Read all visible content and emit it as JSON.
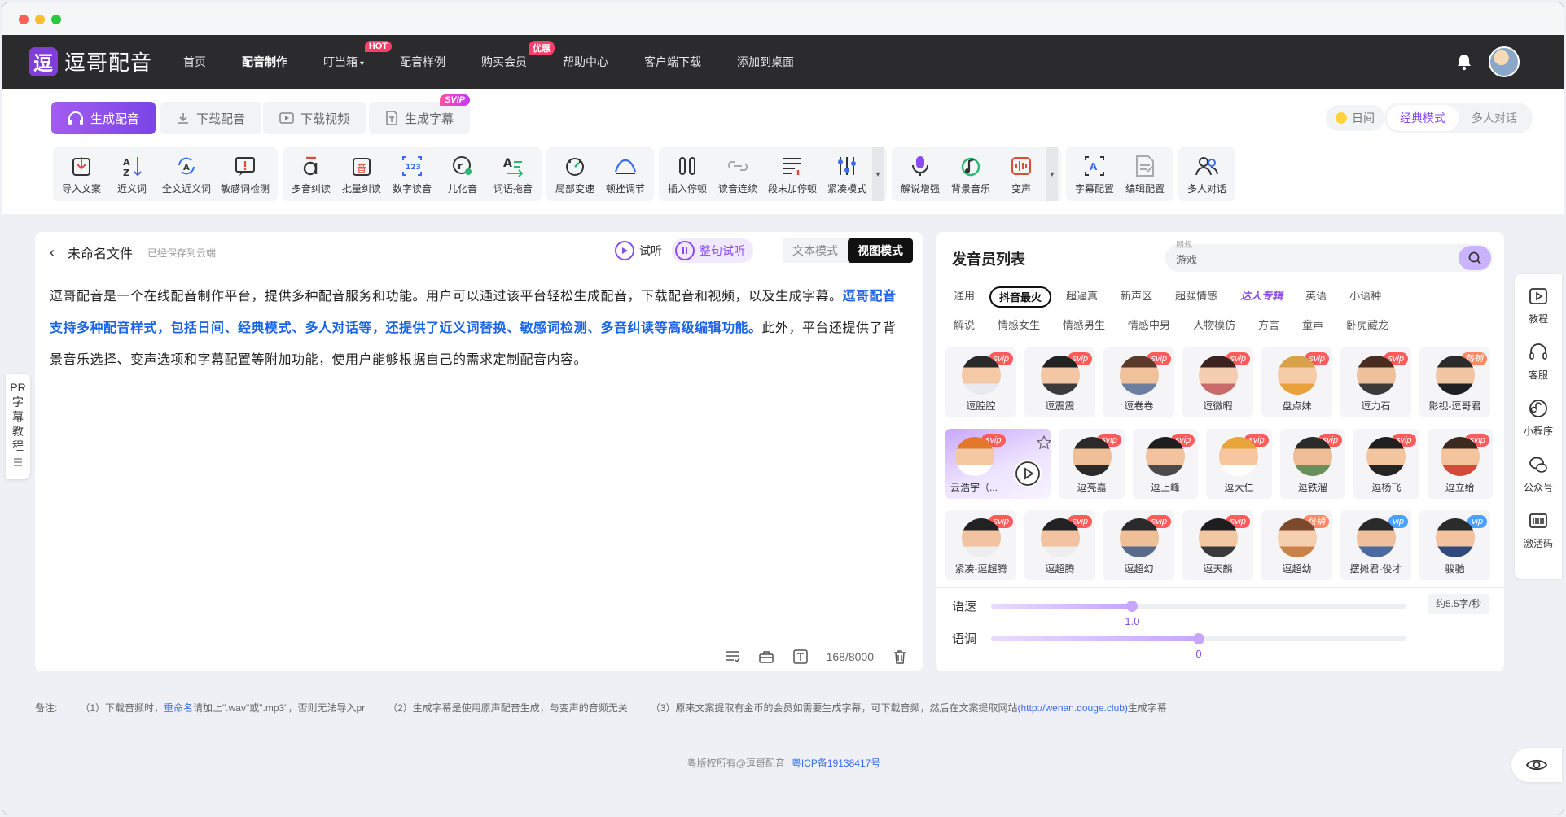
{
  "nav": {
    "logo_mark": "逗",
    "logo_text": "逗哥配音",
    "items": [
      {
        "label": "首页",
        "active": false,
        "badge": ""
      },
      {
        "label": "配音制作",
        "active": true,
        "badge": ""
      },
      {
        "label": "叮当箱",
        "active": false,
        "badge": "HOT",
        "caret": "▾"
      },
      {
        "label": "配音样例",
        "active": false,
        "badge": ""
      },
      {
        "label": "购买会员",
        "active": false,
        "badge": "优惠"
      },
      {
        "label": "帮助中心",
        "active": false,
        "badge": ""
      },
      {
        "label": "客户端下载",
        "active": false,
        "badge": ""
      },
      {
        "label": "添加到桌面",
        "active": false,
        "badge": ""
      }
    ]
  },
  "tabs": [
    {
      "label": "生成配音",
      "icon": "headphone-icon"
    },
    {
      "label": "下载配音",
      "icon": "download-icon"
    },
    {
      "label": "下载视频",
      "icon": "video-icon"
    },
    {
      "label": "生成字幕",
      "icon": "subtitle-icon",
      "badge": "SVIP"
    }
  ],
  "display_mode": "日间",
  "modes": [
    "经典模式",
    "多人对话"
  ],
  "tool_groups": [
    [
      {
        "label": "导入文案"
      },
      {
        "label": "近义词"
      },
      {
        "label": "全文近义词"
      },
      {
        "label": "敏感词检测"
      }
    ],
    [
      {
        "label": "多音纠读"
      },
      {
        "label": "批量纠读"
      },
      {
        "label": "数字读音"
      },
      {
        "label": "儿化音"
      },
      {
        "label": "词语拖音"
      }
    ],
    [
      {
        "label": "局部变速"
      },
      {
        "label": "顿挫调节"
      }
    ],
    [
      {
        "label": "插入停顿"
      },
      {
        "label": "读音连续"
      },
      {
        "label": "段末加停顿"
      },
      {
        "label": "紧凑模式"
      }
    ],
    [
      {
        "label": "解说增强"
      },
      {
        "label": "背景音乐"
      },
      {
        "label": "变声"
      }
    ],
    [
      {
        "label": "字幕配置"
      },
      {
        "label": "编辑配置"
      }
    ],
    [
      {
        "label": "多人对话"
      }
    ]
  ],
  "editor": {
    "back": "‹",
    "title": "未命名文件",
    "saved": "已经保存到云端",
    "preview": "试听",
    "sentence_preview": "整句试听",
    "view_modes": [
      "文本模式",
      "视图模式"
    ],
    "text_part1": "逗哥配音是一个在线配音制作平台，提供多种配音服务和功能。用户可以通过该平台轻松生成配音，下载配音和视频，以及生成字幕。",
    "text_highlight": "逗哥配音支持多种配音样式，包括日间、经典模式、多人对话等，还提供了近义词替换、敏感词检测、多音纠读等高级编辑功能。",
    "text_part2": "此外，平台还提供了背景音乐选择、变声选项和字幕配置等附加功能，使用户能够根据自己的需求定制配音内容。",
    "counter": "168/8000"
  },
  "left_tab": {
    "chars": [
      "PR",
      "字",
      "幕",
      "教",
      "程"
    ]
  },
  "voices": {
    "title": "发音员列表",
    "search_hint": "朗规",
    "search_value": "游戏",
    "categories_row1": [
      "通用",
      "抖音最火",
      "超逼真",
      "新声区",
      "超强情感",
      "达人专辑",
      "英语",
      "小语种"
    ],
    "categories_row2": [
      "解说",
      "情感女生",
      "情感男生",
      "情感中男",
      "人物模仿",
      "方言",
      "童声",
      "卧虎藏龙"
    ],
    "active_category": "抖音最火",
    "rows": [
      [
        {
          "name": "逗腔腔",
          "tag": "svip",
          "skin": "#f6c9a6",
          "hair": "#2a2a2a",
          "shirt": "#e8eaf0"
        },
        {
          "name": "逗震震",
          "tag": "svip",
          "skin": "#f3c7a4",
          "hair": "#222222",
          "shirt": "#3b3b3b"
        },
        {
          "name": "逗卷卷",
          "tag": "svip",
          "skin": "#f0c19b",
          "hair": "#5a3a2a",
          "shirt": "#6c7fa0"
        },
        {
          "name": "逗微暇",
          "tag": "svip",
          "skin": "#f5cdb0",
          "hair": "#3a2320",
          "shirt": "#c96b6b"
        },
        {
          "name": "盘点妹",
          "tag": "svip",
          "skin": "#f6cba8",
          "hair": "#d8a24a",
          "shirt": "#e9a23b"
        },
        {
          "name": "逗力石",
          "tag": "svip",
          "skin": "#efc09c",
          "hair": "#4a2d20",
          "shirt": "#3a3a3a"
        },
        {
          "name": "影视-逗哥君",
          "tag": "热销",
          "skin": "#f1c6a2",
          "hair": "#2b2b2b",
          "shirt": "#1f1f24"
        }
      ],
      [
        {
          "name": "云浩宇（...",
          "tag": "svip",
          "skin": "#f4c8a2",
          "hair": "#e1782a",
          "shirt": "#ffffff",
          "selected": true
        },
        {
          "name": "逗亮嘉",
          "tag": "svip",
          "skin": "#efbf98",
          "hair": "#2a2a2a",
          "shirt": "#2a2a2a"
        },
        {
          "name": "逗上峰",
          "tag": "svip",
          "skin": "#f2c39e",
          "hair": "#1e1e1e",
          "shirt": "#4a4a4a"
        },
        {
          "name": "逗大仁",
          "tag": "svip",
          "skin": "#f6c79e",
          "hair": "#e8a63a",
          "shirt": "#ffffff"
        },
        {
          "name": "逗铁溜",
          "tag": "svip",
          "skin": "#eebd95",
          "hair": "#2b2b2b",
          "shirt": "#6b8f5a"
        },
        {
          "name": "逗杨飞",
          "tag": "svip",
          "skin": "#f3c6a0",
          "hair": "#1f1f1f",
          "shirt": "#242424"
        },
        {
          "name": "逗立给",
          "tag": "svip",
          "skin": "#f4c59c",
          "hair": "#3a2a20",
          "shirt": "#d24a3a"
        }
      ],
      [
        {
          "name": "紧凑-逗超腾",
          "tag": "svip",
          "skin": "#f1c3a0",
          "hair": "#222222",
          "shirt": "#eeeeee"
        },
        {
          "name": "逗超腾",
          "tag": "svip",
          "skin": "#f1c3a0",
          "hair": "#222222",
          "shirt": "#eeeeee"
        },
        {
          "name": "逗超幻",
          "tag": "svip",
          "skin": "#efbf98",
          "hair": "#2a2a2a",
          "shirt": "#5a6a8a"
        },
        {
          "name": "逗天麟",
          "tag": "svip",
          "skin": "#f3c7a2",
          "hair": "#1e1e1e",
          "shirt": "#3a3a3a"
        },
        {
          "name": "逗超幼",
          "tag": "热销",
          "skin": "#f6cfae",
          "hair": "#7a4a2a",
          "shirt": "#c9834a"
        },
        {
          "name": "摆摊君-俊才",
          "tag": "vip",
          "skin": "#efc09c",
          "hair": "#2a2a2a",
          "shirt": "#4b6aa0"
        },
        {
          "name": "骏驰",
          "tag": "vip",
          "skin": "#f2c39e",
          "hair": "#2b2b2b",
          "shirt": "#2f4a7a"
        }
      ]
    ],
    "speed_label": "语速",
    "speed_value": "1.0",
    "speed_fraction": 0.34,
    "speed_rate": "约5.5字/秒",
    "pitch_label": "语调",
    "pitch_value": "0",
    "pitch_fraction": 0.5
  },
  "right_tools": [
    {
      "label": "教程",
      "icon": "play-square-icon"
    },
    {
      "label": "客服",
      "icon": "headset-icon"
    },
    {
      "label": "小程序",
      "icon": "mini-program-icon"
    },
    {
      "label": "公众号",
      "icon": "wechat-icon"
    },
    {
      "label": "激活码",
      "icon": "barcode-icon"
    }
  ],
  "notes": {
    "prefix": "备注:",
    "n1a": "（1）下载音频时，",
    "n1_link": "重命名",
    "n1b": "请加上\".wav\"或\".mp3\"，否则无法导入pr",
    "n2": "（2）生成字幕是使用原声配音生成，与变声的音频无关",
    "n3a": "（3）原来文案提取有金币的会员如需要生成字幕，可下载音频，然后在文案提取网站",
    "n3_link": "(http://wenan.douge.club)",
    "n3b": "生成字幕"
  },
  "footer": {
    "copyright": "粤版权所有@逗哥配音",
    "icp": "粤ICP备19138417号"
  },
  "colors": {
    "accent": "#8a4cf0",
    "link": "#3a6bf0",
    "hot_badge": "#ff3d6b"
  }
}
